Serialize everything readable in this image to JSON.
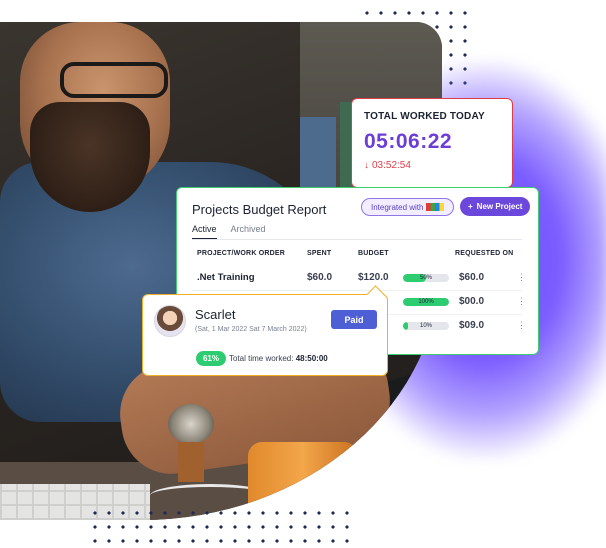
{
  "total_worked": {
    "label": "TOTAL WORKED TODAY",
    "time": "05:06:22",
    "delta": "03:52:54",
    "delta_icon": "arrow-down-icon",
    "accent": "#6b3fd6",
    "delta_color": "#e23b48"
  },
  "report": {
    "title": "Projects Budget Report",
    "integrated_label": "Integrated with",
    "integrated_logo": "zoho-logo",
    "new_project_label": "New Project",
    "tabs": {
      "active": "Active",
      "archived": "Archived"
    },
    "columns": {
      "project": "PROJECT/WORK ORDER",
      "spent": "SPENT",
      "budget": "BUDGET",
      "requested": "REQUESTED ON"
    },
    "rows": [
      {
        "name": ".Net Training",
        "spent": "$60.0",
        "budget": "$120.0",
        "progress_label": "50%",
        "progress": 0.5,
        "requested": "$60.0"
      },
      {
        "name": "",
        "spent": "",
        "budget": "",
        "progress_label": "100%",
        "progress": 1.0,
        "requested": "$00.0"
      },
      {
        "name": "",
        "spent": "",
        "budget": "",
        "progress_label": "10%",
        "progress": 0.1,
        "requested": "$09.0"
      }
    ],
    "border_color": "#3ccf6e"
  },
  "scarlet": {
    "name": "Scarlet",
    "date_range": "(Sat, 1 Mar 2022 Sat 7 March 2022)",
    "status": "Paid",
    "percent": "61%",
    "total_label": "Total time worked:",
    "total_value": "48:50:00",
    "border_color": "#f0b129"
  }
}
